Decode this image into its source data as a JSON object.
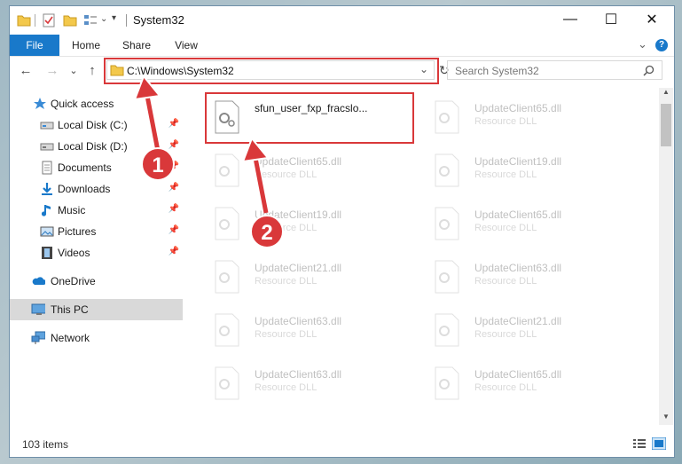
{
  "window": {
    "title": "System32",
    "controls": {
      "minimize": "—",
      "maximize": "☐",
      "close": "✕"
    }
  },
  "ribbon": {
    "tabs": [
      "File",
      "Home",
      "Share",
      "View"
    ],
    "expand_glyph": "⌄",
    "help_glyph": "?"
  },
  "navigation": {
    "back": "←",
    "forward": "→",
    "recent": "⌄",
    "up": "↑",
    "address": "C:\\Windows\\System32",
    "address_dropdown": "⌄",
    "refresh": "↻",
    "search_placeholder": "Search System32"
  },
  "sidebar": {
    "items": [
      {
        "label": "Quick access",
        "icon": "star-icon",
        "pinned": false
      },
      {
        "label": "Local Disk (C:)",
        "icon": "drive-icon",
        "pinned": true
      },
      {
        "label": "Local Disk (D:)",
        "icon": "drive-icon",
        "pinned": true
      },
      {
        "label": "Documents",
        "icon": "document-icon",
        "pinned": true
      },
      {
        "label": "Downloads",
        "icon": "download-icon",
        "pinned": true
      },
      {
        "label": "Music",
        "icon": "music-icon",
        "pinned": true
      },
      {
        "label": "Pictures",
        "icon": "picture-icon",
        "pinned": true
      },
      {
        "label": "Videos",
        "icon": "video-icon",
        "pinned": true
      },
      {
        "label": "OneDrive",
        "icon": "cloud-icon",
        "pinned": false
      },
      {
        "label": "This PC",
        "icon": "computer-icon",
        "pinned": false,
        "selected": true
      },
      {
        "label": "Network",
        "icon": "network-icon",
        "pinned": false
      }
    ]
  },
  "files": {
    "left_column": [
      {
        "name": "sfun_user_fxp_fracslo...",
        "type": "",
        "highlighted": true
      },
      {
        "name": "UpdateClient65.dll",
        "type": "Resource DLL"
      },
      {
        "name": "UpdateClient19.dll",
        "type": "Resource DLL"
      },
      {
        "name": "UpdateClient21.dll",
        "type": "Resource DLL"
      },
      {
        "name": "UpdateClient63.dll",
        "type": "Resource DLL"
      },
      {
        "name": "UpdateClient63.dll",
        "type": "Resource DLL"
      }
    ],
    "right_column": [
      {
        "name": "UpdateClient65.dll",
        "type": "Resource DLL"
      },
      {
        "name": "UpdateClient19.dll",
        "type": "Resource DLL"
      },
      {
        "name": "UpdateClient65.dll",
        "type": "Resource DLL"
      },
      {
        "name": "UpdateClient63.dll",
        "type": "Resource DLL"
      },
      {
        "name": "UpdateClient21.dll",
        "type": "Resource DLL"
      },
      {
        "name": "UpdateClient65.dll",
        "type": "Resource DLL"
      }
    ]
  },
  "status": {
    "item_count": "103 items"
  },
  "callouts": {
    "one": "1",
    "two": "2"
  },
  "colors": {
    "accent": "#1979ca",
    "highlight": "#d9383a",
    "folder": "#f3c84b"
  }
}
